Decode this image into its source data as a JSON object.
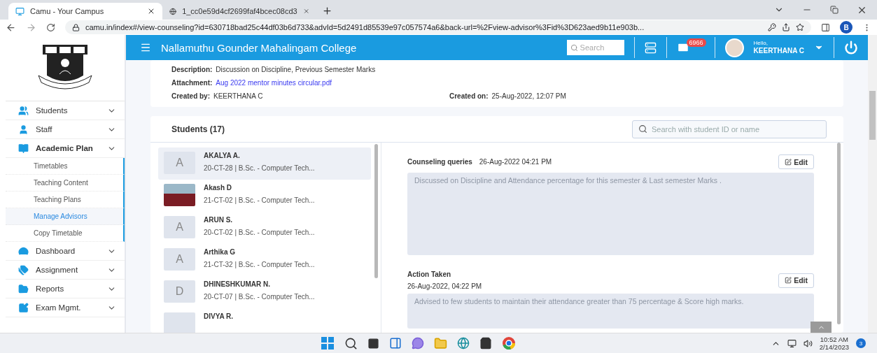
{
  "browser": {
    "tabs": [
      {
        "title": "Camu - Your Campus",
        "selected": true
      },
      {
        "title": "1_cc0e59d4cf2699faf4bcec08cd3",
        "selected": false
      }
    ],
    "url": "camu.in/index#/view-counseling?id=630718bad25c44df03b6d733&advId=5d2491d85539e97c057574a6&back-url=%2Fview-advisor%3Fid%3D623aed9b11e903b...",
    "profile_initial": "B"
  },
  "sidebar": {
    "items": [
      {
        "label": "Students",
        "expanded": false
      },
      {
        "label": "Staff",
        "expanded": false
      },
      {
        "label": "Academic Plan",
        "expanded": true,
        "children": [
          {
            "label": "Timetables",
            "selected": false
          },
          {
            "label": "Teaching Content",
            "selected": false
          },
          {
            "label": "Teaching Plans",
            "selected": false
          },
          {
            "label": "Manage Advisors",
            "selected": true
          },
          {
            "label": "Copy Timetable",
            "selected": false
          }
        ]
      },
      {
        "label": "Dashboard",
        "expanded": false
      },
      {
        "label": "Assignment",
        "expanded": false
      },
      {
        "label": "Reports",
        "expanded": false
      },
      {
        "label": "Exam Mgmt.",
        "expanded": false
      }
    ]
  },
  "header": {
    "title": "Nallamuthu Gounder Mahalingam College",
    "search_placeholder": "Search",
    "mail_count": "6966",
    "greeting": "Hello,",
    "user": "KEERTHANA C"
  },
  "session": {
    "fields": [
      {
        "label": "Description:",
        "value": "Discussion on Discipline, Previous Semester Marks",
        "kind": "text"
      },
      {
        "label": "Attachment:",
        "value": "Aug 2022 mentor minutes circular.pdf",
        "kind": "link"
      },
      {
        "label": "Created by:",
        "value": "KEERTHANA C",
        "kind": "text"
      }
    ],
    "created_on": {
      "label": "Created on:",
      "value": "25-Aug-2022, 12:07 PM"
    }
  },
  "students": {
    "title": "Students (17)",
    "search_placeholder": "Search with student ID or name",
    "items": [
      {
        "kind": "letter",
        "initial": "A",
        "name": "AKALYA A.",
        "info": "20-CT-28 | B.Sc. - Computer Tech...",
        "selected": true
      },
      {
        "kind": "photo",
        "name": "Akash D",
        "info": "21-CT-02 | B.Sc. - Computer Tech...",
        "selected": false
      },
      {
        "kind": "letter",
        "initial": "A",
        "name": "ARUN S.",
        "info": "20-CT-02 | B.Sc. - Computer Tech...",
        "selected": false
      },
      {
        "kind": "letter",
        "initial": "A",
        "name": "Arthika G",
        "info": "21-CT-32 | B.Sc. - Computer Tech...",
        "selected": false
      },
      {
        "kind": "letter",
        "initial": "D",
        "name": "DHINESHKUMAR N.",
        "info": "20-CT-07 | B.Sc. - Computer Tech...",
        "selected": false
      },
      {
        "kind": "blank",
        "name": "DIVYA R.",
        "selected": false
      }
    ]
  },
  "detail": {
    "queries": {
      "label": "Counseling queries",
      "time": "26-Aug-2022 04:21 PM",
      "text": "Discussed on Discipline and Attendance percentage for this semester & Last semester Marks .",
      "button": "Edit"
    },
    "action": {
      "label": "Action Taken",
      "time": "26-Aug-2022, 04:22 PM",
      "text": "Advised to few students to maintain their attendance greater than 75 percentage & Score high marks.",
      "button": "Edit"
    }
  },
  "taskbar": {
    "time": "10:52 AM",
    "date": "2/14/2023",
    "notification_count": "3"
  }
}
